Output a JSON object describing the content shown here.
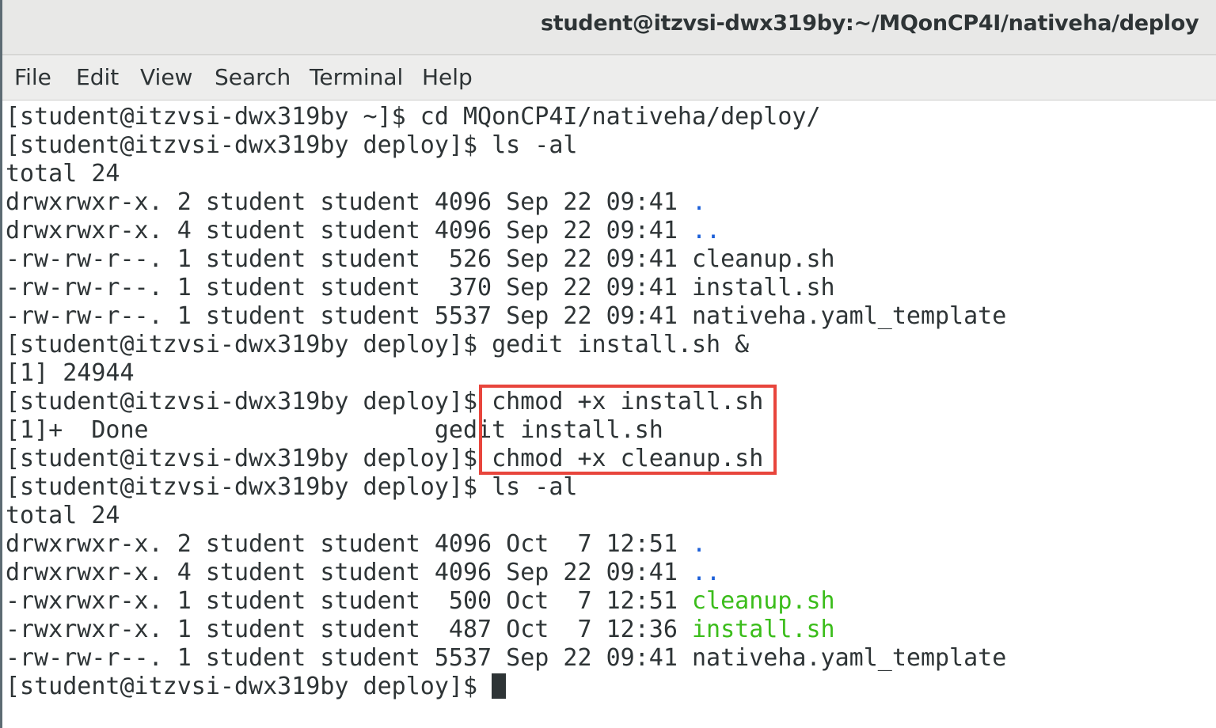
{
  "window": {
    "title": "student@itzvsi-dwx319by:~/MQonCP4I/nativeha/deploy"
  },
  "menu": {
    "file": "File",
    "edit": "Edit",
    "view": "View",
    "search": "Search",
    "terminal": "Terminal",
    "help": "Help"
  },
  "terminal": {
    "l0": "[student@itzvsi-dwx319by ~]$ cd MQonCP4I/nativeha/deploy/",
    "l1": "[student@itzvsi-dwx319by deploy]$ ls -al",
    "l2": "total 24",
    "l3_meta": "drwxrwxr-x. 2 student student 4096 Sep 22 09:41 ",
    "l3_name": ".",
    "l4_meta": "drwxrwxr-x. 4 student student 4096 Sep 22 09:41 ",
    "l4_name": "..",
    "l5_meta": "-rw-rw-r--. 1 student student  526 Sep 22 09:41 ",
    "l5_name": "cleanup.sh",
    "l6_meta": "-rw-rw-r--. 1 student student  370 Sep 22 09:41 ",
    "l6_name": "install.sh",
    "l7_meta": "-rw-rw-r--. 1 student student 5537 Sep 22 09:41 ",
    "l7_name": "nativeha.yaml_template",
    "l8": "[student@itzvsi-dwx319by deploy]$ gedit install.sh &",
    "l9": "[1] 24944",
    "l10": "[student@itzvsi-dwx319by deploy]$ chmod +x install.sh",
    "l11": "[1]+  Done                    gedit install.sh",
    "l12": "[student@itzvsi-dwx319by deploy]$ chmod +x cleanup.sh",
    "l13": "[student@itzvsi-dwx319by deploy]$ ls -al",
    "l14": "total 24",
    "l15_meta": "drwxrwxr-x. 2 student student 4096 Oct  7 12:51 ",
    "l15_name": ".",
    "l16_meta": "drwxrwxr-x. 4 student student 4096 Sep 22 09:41 ",
    "l16_name": "..",
    "l17_meta": "-rwxrwxr-x. 1 student student  500 Oct  7 12:51 ",
    "l17_name": "cleanup.sh",
    "l18_meta": "-rwxrwxr-x. 1 student student  487 Oct  7 12:36 ",
    "l18_name": "install.sh",
    "l19_meta": "-rw-rw-r--. 1 student student 5537 Sep 22 09:41 ",
    "l19_name": "nativeha.yaml_template",
    "l20_prompt": "[student@itzvsi-dwx319by deploy]$ "
  },
  "colors": {
    "directory": "#1c5fd8",
    "executable": "#3bbd1b",
    "highlight_box": "#e8453c",
    "text": "#2e3436"
  },
  "icons": {
    "cursor": "block-cursor"
  }
}
